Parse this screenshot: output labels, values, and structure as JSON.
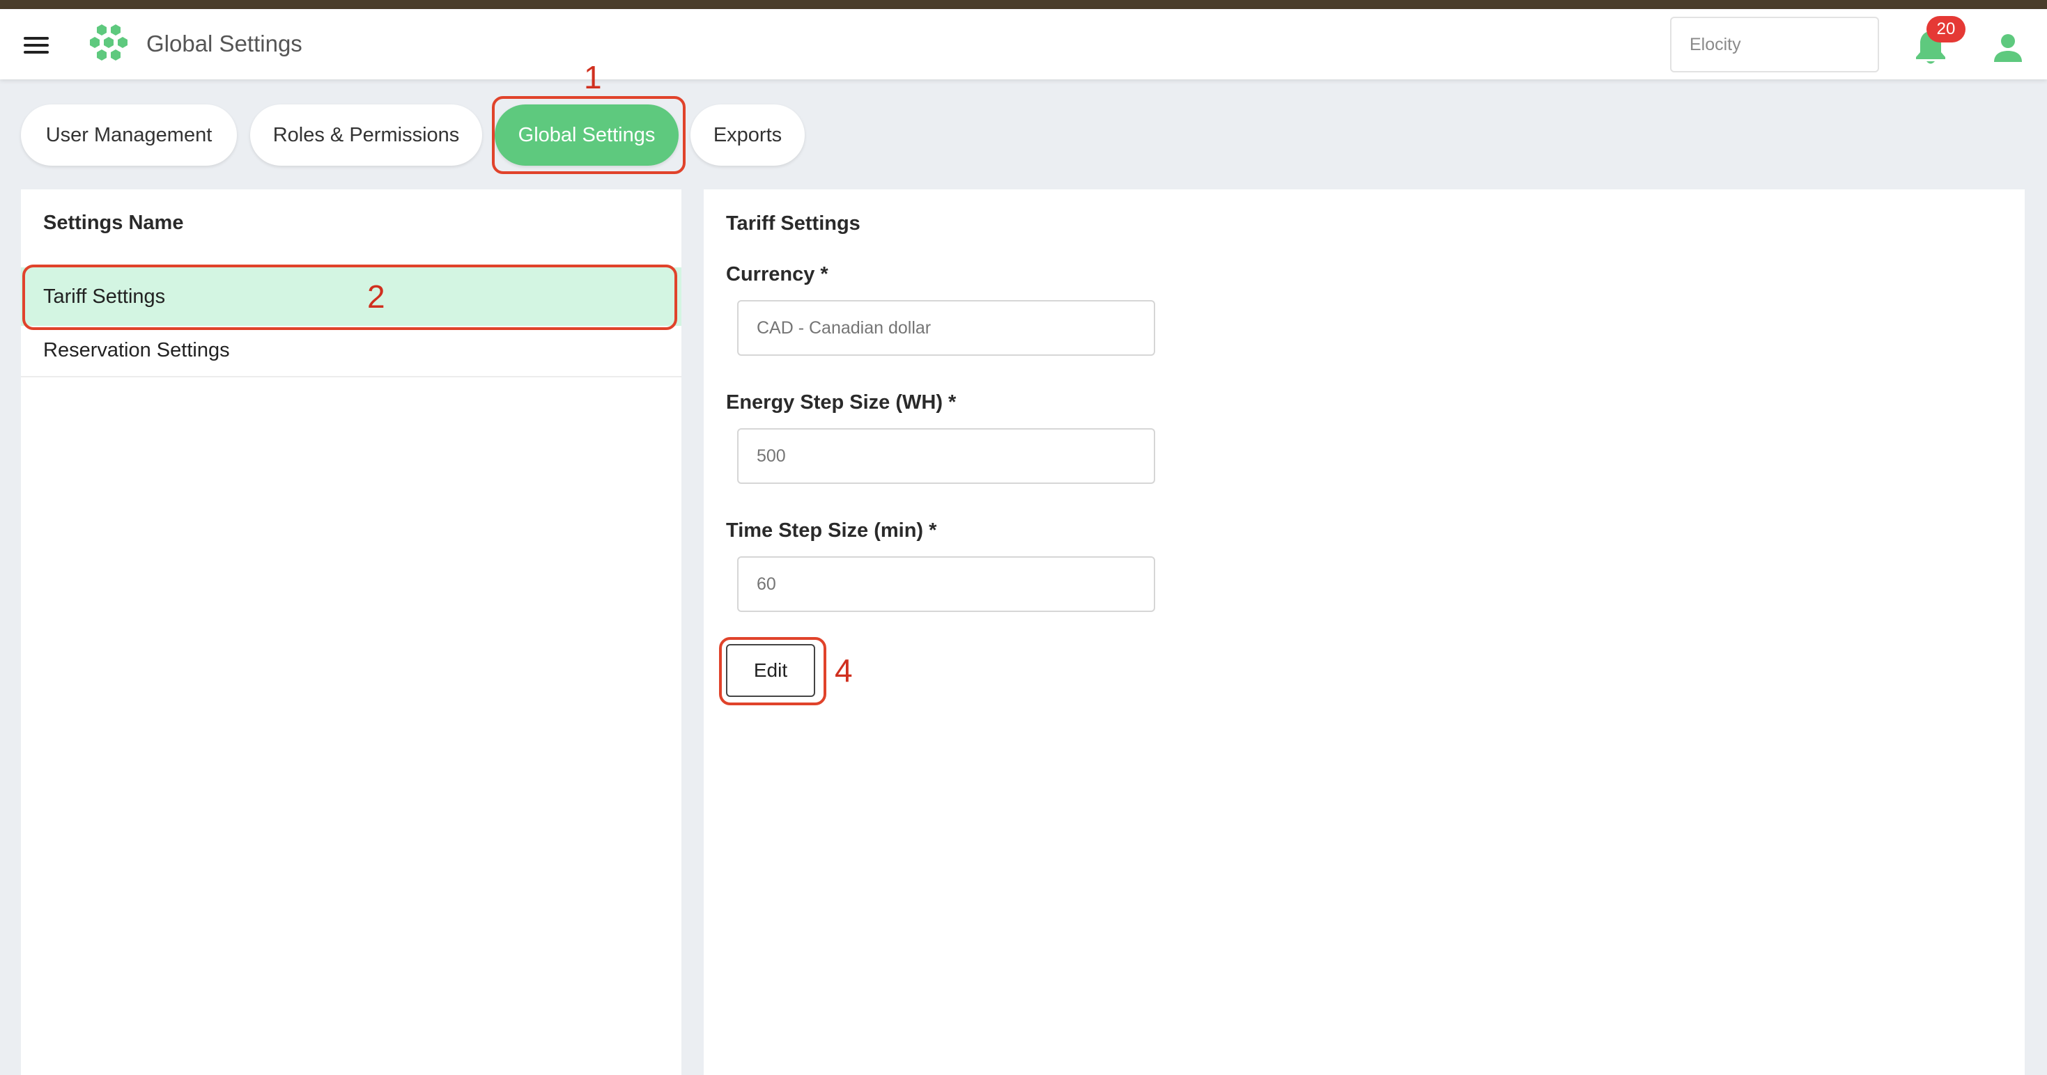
{
  "header": {
    "title": "Global Settings",
    "org_select": "Elocity",
    "notification_count": "20"
  },
  "tabs": [
    {
      "label": "User Management",
      "active": false
    },
    {
      "label": "Roles & Permissions",
      "active": false
    },
    {
      "label": "Global Settings",
      "active": true
    },
    {
      "label": "Exports",
      "active": false
    }
  ],
  "settings_list": {
    "title": "Settings Name",
    "items": [
      {
        "label": "Tariff Settings",
        "selected": true
      },
      {
        "label": "Reservation Settings",
        "selected": false
      }
    ]
  },
  "tariff": {
    "title": "Tariff Settings",
    "currency_label": "Currency *",
    "currency_placeholder": "CAD - Canadian dollar",
    "energy_label": "Energy Step Size (WH) *",
    "energy_placeholder": "500",
    "time_label": "Time Step Size (min) *",
    "time_placeholder": "60",
    "edit_label": "Edit"
  },
  "annotations": [
    "1",
    "2",
    "4"
  ],
  "colors": {
    "accent": "#5ec97e",
    "selected_bg": "#d3f5e2",
    "annotation": "#e0432b",
    "badge": "#e53935"
  }
}
